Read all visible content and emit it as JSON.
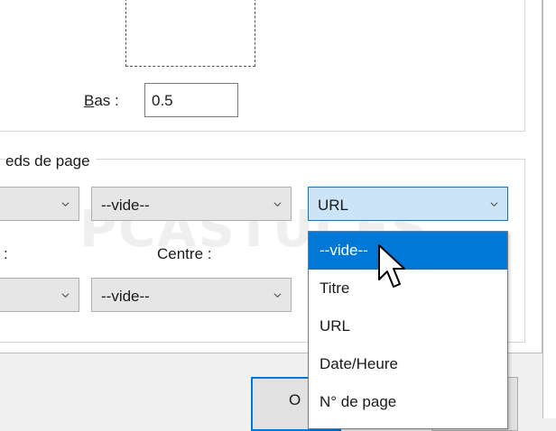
{
  "margins": {
    "bottom_label_prefix": "B",
    "bottom_label_rest": "as :",
    "bottom_value": "0.5"
  },
  "header_footer": {
    "legend": "eds de page",
    "center_label": "Centre :",
    "left_label_fragment": ":",
    "header_left_value": "",
    "header_center_value": "--vide--",
    "header_right_value": "URL",
    "footer_left_value": "",
    "footer_center_value": "--vide--"
  },
  "dropdown": {
    "options": [
      "--vide--",
      "Titre",
      "URL",
      "Date/Heure",
      "N° de page"
    ],
    "highlighted_index": 0
  },
  "buttons": {
    "ok_fragment": "O"
  },
  "watermark": "PCASTUCES",
  "colors": {
    "accent": "#0078d7",
    "active_select": "#cce4f7",
    "select_bg": "#e6e6e6"
  }
}
